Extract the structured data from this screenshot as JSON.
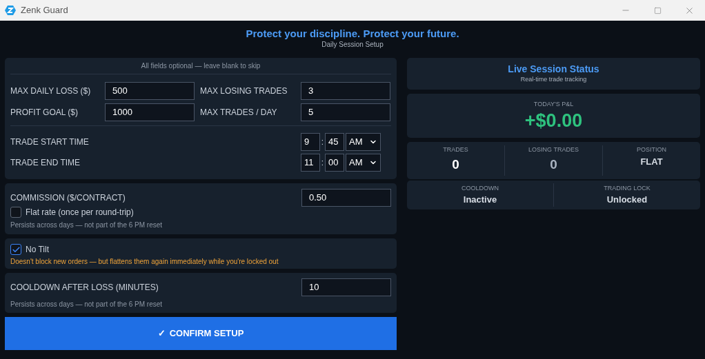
{
  "window": {
    "title": "Zenk Guard"
  },
  "header": {
    "title": "Protect your discipline. Protect your future.",
    "subtitle": "Daily Session Setup"
  },
  "limits": {
    "note": "All fields optional — leave blank to skip",
    "fields": [
      {
        "label": "MAX DAILY LOSS ($)",
        "value": "500"
      },
      {
        "label": "MAX LOSING TRADES",
        "value": "3"
      },
      {
        "label": "PROFIT GOAL ($)",
        "value": "1000"
      },
      {
        "label": "MAX TRADES / DAY",
        "value": "5"
      }
    ],
    "times": [
      {
        "label": "TRADE START TIME",
        "hour": "9",
        "separator": ":",
        "minute": "45",
        "period": "AM"
      },
      {
        "label": "TRADE END TIME",
        "hour": "11",
        "separator": ":",
        "minute": "00",
        "period": "AM"
      }
    ]
  },
  "commission": {
    "label": "COMMISSION ($/CONTRACT)",
    "value": "0.50",
    "option": {
      "label": "Flat rate (once per round-trip)",
      "checked": false
    },
    "note": "Persists across days — not part of the 6 PM reset"
  },
  "no_tilt": {
    "label": "No Tilt",
    "checked": true,
    "note": "Doesn't block new orders — but flattens them again immediately while you're locked out"
  },
  "cooldown": {
    "label": "COOLDOWN AFTER LOSS (MINUTES)",
    "value": "10",
    "note": "Persists across days — not part of the 6 PM reset"
  },
  "confirm_button": {
    "icon": "✓",
    "label": "CONFIRM SETUP"
  },
  "status": {
    "title": "Live Session Status",
    "subtitle": "Real-time trade tracking",
    "pnl": {
      "label": "TODAY'S P&L",
      "value": "+$0.00"
    },
    "stats": [
      {
        "label": "TRADES",
        "value": "0",
        "color": "#ffffff"
      },
      {
        "label": "LOSING TRADES",
        "value": "0",
        "color": "#aab4c2"
      },
      {
        "label": "POSITION",
        "value": "FLAT",
        "color": "#d6dce4"
      }
    ],
    "states": [
      {
        "label": "COOLDOWN",
        "value": "Inactive"
      },
      {
        "label": "TRADING LOCK",
        "value": "Unlocked"
      }
    ]
  }
}
